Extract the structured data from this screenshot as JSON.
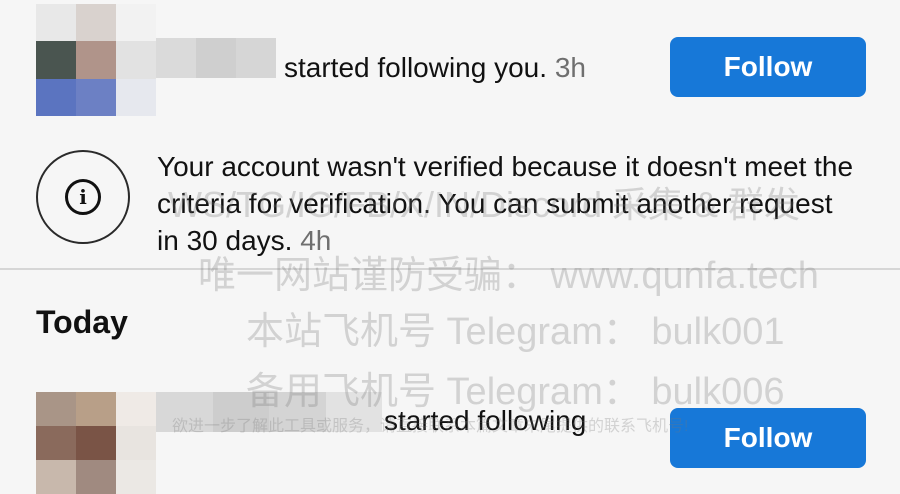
{
  "notifications": [
    {
      "type": "follow",
      "text": "started following you.",
      "time": "3h",
      "button_label": "Follow"
    },
    {
      "type": "system",
      "icon": "info-icon",
      "message": "Your account wasn't verified because it doesn't meet the criteria for verification. You can submit another request in 30 days.",
      "time": "4h"
    }
  ],
  "today": {
    "section_title": "Today",
    "items": [
      {
        "type": "follow",
        "text": "started following",
        "button_label": "Follow"
      }
    ]
  },
  "watermark": {
    "line1": "WS/TG/IG/FB/X/IN/Discord  采集 & 群发",
    "line2": "唯一网站谨防受骗：  www.qunfa.tech",
    "line3": "本站飞机号 Telegram：  bulk001",
    "line4": "备用飞机号 Telegram：  bulk006",
    "line5": "欲进一步了解此工具或服务，请直接联系本篇文章末尾提供的联系飞机号!"
  },
  "colors": {
    "accent": "#1778d8",
    "background": "#f6f6f6",
    "divider": "#d6d6d6"
  }
}
